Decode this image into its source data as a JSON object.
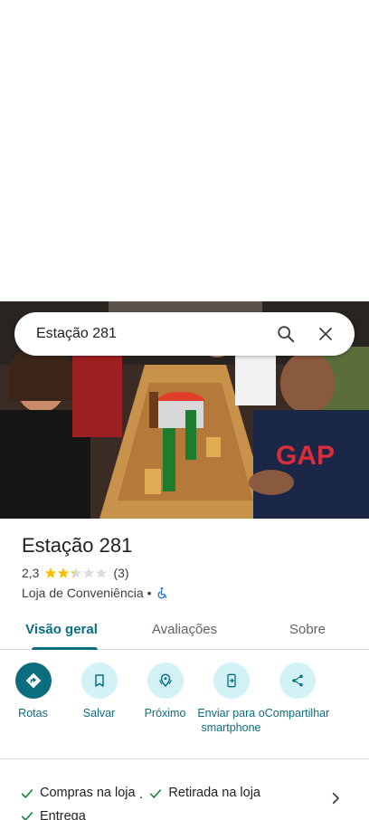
{
  "search": {
    "query": "Estação 281"
  },
  "place": {
    "name": "Estação 281",
    "rating": "2,3",
    "rating_value": 2.3,
    "review_count": "(3)",
    "category": "Loja de Conveniência",
    "separator": "•"
  },
  "tabs": [
    {
      "label": "Visão geral",
      "active": true
    },
    {
      "label": "Avaliações",
      "active": false
    },
    {
      "label": "Sobre",
      "active": false
    }
  ],
  "actions": [
    {
      "label": "Rotas",
      "icon": "directions-icon"
    },
    {
      "label": "Salvar",
      "icon": "bookmark-icon"
    },
    {
      "label": "Próximo",
      "icon": "nearby-icon"
    },
    {
      "label": "Enviar para o smartphone",
      "icon": "send-to-phone-icon"
    },
    {
      "label": "Compartilhar",
      "icon": "share-icon"
    }
  ],
  "services": {
    "items": [
      "Compras na loja",
      "Retirada na loja",
      "Entrega"
    ],
    "separator": "·"
  },
  "colors": {
    "accent": "#0b6e7f",
    "accent_light": "#d3f2f6",
    "star": "#fbbc04",
    "check": "#188038"
  }
}
